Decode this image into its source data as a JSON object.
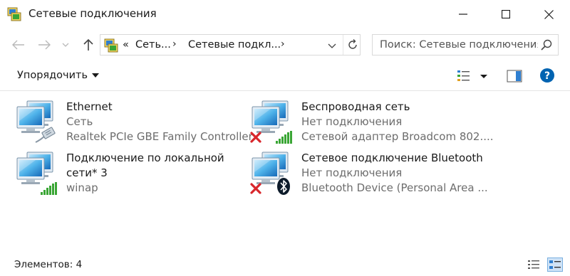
{
  "window": {
    "title": "Сетевые подключения"
  },
  "navigation": {
    "breadcrumb_overflow": "«",
    "breadcrumbs": [
      "Сеть...",
      "Сетевые подкл..."
    ],
    "search_placeholder": "Поиск: Сетевые подключения"
  },
  "toolbar": {
    "organize_label": "Упорядочить"
  },
  "connections": [
    {
      "name": "Ethernet",
      "status": "Сеть",
      "device": "Realtek PCIe GBE Family Controller",
      "icon": "ethernet-cable-icon"
    },
    {
      "name": "Беспроводная сеть",
      "status": "Нет подключения",
      "device": "Сетевой адаптер Broadcom 802....",
      "icon": "wifi-signal-icon"
    },
    {
      "name_line1": "Подключение по локальной",
      "name_line2": "сети* 3",
      "device": "winap",
      "icon": "wifi-signal-icon"
    },
    {
      "name": "Сетевое подключение Bluetooth",
      "status": "Нет подключения",
      "device": "Bluetooth Device (Personal Area ...",
      "icon": "bluetooth-icon"
    }
  ],
  "statusbar": {
    "items_count": "Элементов: 4"
  },
  "colors": {
    "accent": "#0063b1",
    "signal_green": "#3aa635",
    "error_red": "#d8262b"
  }
}
